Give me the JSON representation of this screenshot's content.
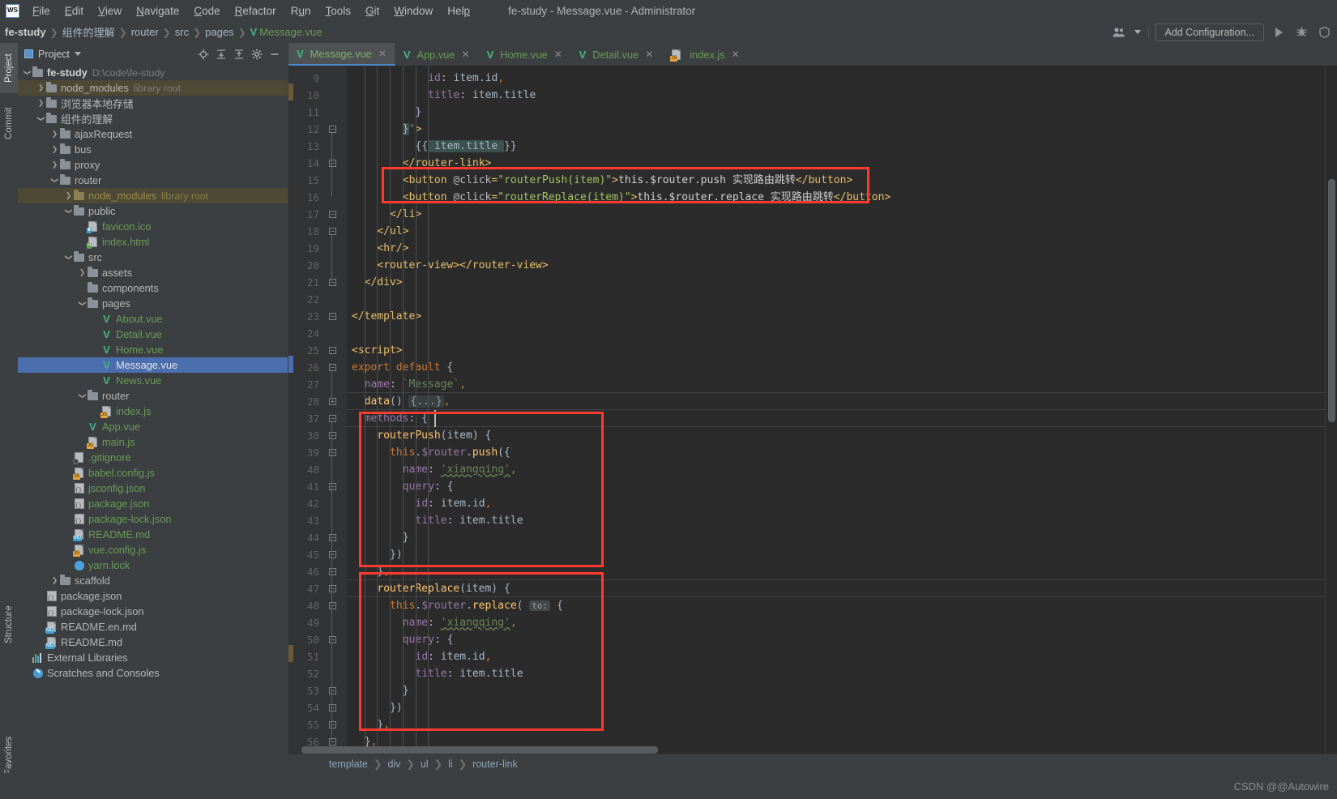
{
  "window": {
    "title": "fe-study - Message.vue - Administrator",
    "logo_text": "WS"
  },
  "menubar": {
    "items": [
      {
        "label": "File",
        "mnemonic": "F"
      },
      {
        "label": "Edit",
        "mnemonic": "E"
      },
      {
        "label": "View",
        "mnemonic": "V"
      },
      {
        "label": "Navigate",
        "mnemonic": "N"
      },
      {
        "label": "Code",
        "mnemonic": "C"
      },
      {
        "label": "Refactor",
        "mnemonic": "R"
      },
      {
        "label": "Run",
        "mnemonic": "u"
      },
      {
        "label": "Tools",
        "mnemonic": "T"
      },
      {
        "label": "Git",
        "mnemonic": "G"
      },
      {
        "label": "Window",
        "mnemonic": "W"
      },
      {
        "label": "Help",
        "mnemonic": "H"
      }
    ]
  },
  "navbar": {
    "crumbs": [
      "fe-study",
      "组件的理解",
      "router",
      "src",
      "pages",
      "Message.vue"
    ],
    "run_config_label": "Add Configuration...",
    "icons": [
      "user-group-icon",
      "run-icon",
      "debug-icon",
      "coverage-icon"
    ]
  },
  "toolstrip": {
    "left_top": [
      "Project",
      "Commit"
    ],
    "left_bottom": [
      "Structure",
      "Favorites"
    ]
  },
  "project_panel": {
    "title": "Project",
    "icons": [
      "locate-icon",
      "expand-all-icon",
      "collapse-all-icon",
      "settings-icon",
      "hide-icon"
    ]
  },
  "tree": [
    {
      "depth": 0,
      "arrow": "down",
      "icon": "folder",
      "label": "fe-study",
      "sub": "D:\\code\\fe-study",
      "style": "bold"
    },
    {
      "depth": 1,
      "arrow": "right",
      "icon": "folder",
      "label": "node_modules",
      "sub": "library root",
      "row": "hl"
    },
    {
      "depth": 1,
      "arrow": "right",
      "icon": "folder",
      "label": "浏览器本地存储",
      "sub": ""
    },
    {
      "depth": 1,
      "arrow": "down",
      "icon": "folder",
      "label": "组件的理解",
      "sub": ""
    },
    {
      "depth": 2,
      "arrow": "right",
      "icon": "folder",
      "label": "ajaxRequest",
      "sub": ""
    },
    {
      "depth": 2,
      "arrow": "right",
      "icon": "folder",
      "label": "bus",
      "sub": ""
    },
    {
      "depth": 2,
      "arrow": "right",
      "icon": "folder",
      "label": "proxy",
      "sub": ""
    },
    {
      "depth": 2,
      "arrow": "down",
      "icon": "folder",
      "label": "router",
      "sub": ""
    },
    {
      "depth": 3,
      "arrow": "right",
      "icon": "folder-olive",
      "label": "node_modules",
      "sub": "library root",
      "row": "hl",
      "style": "olive"
    },
    {
      "depth": 3,
      "arrow": "down",
      "icon": "folder",
      "label": "public",
      "sub": ""
    },
    {
      "depth": 4,
      "arrow": "none",
      "icon": "file-img",
      "label": "favicon.ico",
      "sub": "",
      "style": "green"
    },
    {
      "depth": 4,
      "arrow": "none",
      "icon": "file-html",
      "label": "index.html",
      "sub": "",
      "style": "green"
    },
    {
      "depth": 3,
      "arrow": "down",
      "icon": "folder",
      "label": "src",
      "sub": ""
    },
    {
      "depth": 4,
      "arrow": "right",
      "icon": "folder",
      "label": "assets",
      "sub": ""
    },
    {
      "depth": 4,
      "arrow": "none",
      "icon": "folder",
      "label": "components",
      "sub": ""
    },
    {
      "depth": 4,
      "arrow": "down",
      "icon": "folder",
      "label": "pages",
      "sub": ""
    },
    {
      "depth": 5,
      "arrow": "none",
      "icon": "vue",
      "label": "About.vue",
      "sub": "",
      "style": "green"
    },
    {
      "depth": 5,
      "arrow": "none",
      "icon": "vue",
      "label": "Detail.vue",
      "sub": "",
      "style": "green"
    },
    {
      "depth": 5,
      "arrow": "none",
      "icon": "vue",
      "label": "Home.vue",
      "sub": "",
      "style": "green"
    },
    {
      "depth": 5,
      "arrow": "none",
      "icon": "vue",
      "label": "Message.vue",
      "sub": "",
      "row": "sel",
      "style": "white"
    },
    {
      "depth": 5,
      "arrow": "none",
      "icon": "vue",
      "label": "News.vue",
      "sub": "",
      "style": "green"
    },
    {
      "depth": 4,
      "arrow": "down",
      "icon": "folder",
      "label": "router",
      "sub": ""
    },
    {
      "depth": 5,
      "arrow": "none",
      "icon": "file-js",
      "label": "index.js",
      "sub": "",
      "style": "green"
    },
    {
      "depth": 4,
      "arrow": "none",
      "icon": "vue",
      "label": "App.vue",
      "sub": "",
      "style": "green"
    },
    {
      "depth": 4,
      "arrow": "none",
      "icon": "file-js",
      "label": "main.js",
      "sub": "",
      "style": "green"
    },
    {
      "depth": 3,
      "arrow": "none",
      "icon": "gitignore",
      "label": ".gitignore",
      "sub": "",
      "style": "green"
    },
    {
      "depth": 3,
      "arrow": "none",
      "icon": "file-js",
      "label": "babel.config.js",
      "sub": "",
      "style": "green"
    },
    {
      "depth": 3,
      "arrow": "none",
      "icon": "json",
      "label": "jsconfig.json",
      "sub": "",
      "style": "green"
    },
    {
      "depth": 3,
      "arrow": "none",
      "icon": "json",
      "label": "package.json",
      "sub": "",
      "style": "green"
    },
    {
      "depth": 3,
      "arrow": "none",
      "icon": "json",
      "label": "package-lock.json",
      "sub": "",
      "style": "green"
    },
    {
      "depth": 3,
      "arrow": "none",
      "icon": "file-md",
      "label": "README.md",
      "sub": "",
      "style": "green"
    },
    {
      "depth": 3,
      "arrow": "none",
      "icon": "file-js",
      "label": "vue.config.js",
      "sub": "",
      "style": "green"
    },
    {
      "depth": 3,
      "arrow": "none",
      "icon": "yarn",
      "label": "yarn.lock",
      "sub": "",
      "style": "green"
    },
    {
      "depth": 2,
      "arrow": "right",
      "icon": "folder",
      "label": "scaffold",
      "sub": ""
    },
    {
      "depth": 1,
      "arrow": "none",
      "icon": "json",
      "label": "package.json",
      "sub": ""
    },
    {
      "depth": 1,
      "arrow": "none",
      "icon": "json",
      "label": "package-lock.json",
      "sub": ""
    },
    {
      "depth": 1,
      "arrow": "none",
      "icon": "file-md",
      "label": "README.en.md",
      "sub": ""
    },
    {
      "depth": 1,
      "arrow": "none",
      "icon": "file-md",
      "label": "README.md",
      "sub": ""
    },
    {
      "depth": 0,
      "arrow": "none",
      "icon": "libs",
      "label": "External Libraries",
      "sub": ""
    },
    {
      "depth": 0,
      "arrow": "none",
      "icon": "scratch",
      "label": "Scratches and Consoles",
      "sub": ""
    }
  ],
  "tabs": [
    {
      "label": "Message.vue",
      "icon": "vue-icon",
      "active": true
    },
    {
      "label": "App.vue",
      "icon": "vue-icon",
      "active": false
    },
    {
      "label": "Home.vue",
      "icon": "vue-icon",
      "active": false
    },
    {
      "label": "Detail.vue",
      "icon": "vue-icon",
      "active": false
    },
    {
      "label": "index.js",
      "icon": "js-icon",
      "active": false
    }
  ],
  "editor": {
    "filename": "Message.vue",
    "first_visible_line": 9,
    "last_visible_line": 56,
    "folded_range": "29-36",
    "lines": [
      {
        "n": 9,
        "text": "            id: item.id,"
      },
      {
        "n": 10,
        "text": "            title: item.title"
      },
      {
        "n": 11,
        "text": "          }"
      },
      {
        "n": 12,
        "text": "        }\">"
      },
      {
        "n": 13,
        "text": "          {{ item.title }}"
      },
      {
        "n": 14,
        "text": "        </router-link>"
      },
      {
        "n": 15,
        "text": "        <button @click=\"routerPush(item)\">this.$router.push 实现路由跳转</button>"
      },
      {
        "n": 16,
        "text": "        <button @click=\"routerReplace(item)\">this.$router.replace 实现路由跳转</button>"
      },
      {
        "n": 17,
        "text": "      </li>"
      },
      {
        "n": 18,
        "text": "    </ul>"
      },
      {
        "n": 19,
        "text": "    <hr/>"
      },
      {
        "n": 20,
        "text": "    <router-view></router-view>"
      },
      {
        "n": 21,
        "text": "  </div>"
      },
      {
        "n": 22,
        "text": ""
      },
      {
        "n": 23,
        "text": "</template>"
      },
      {
        "n": 24,
        "text": ""
      },
      {
        "n": 25,
        "text": "<script>"
      },
      {
        "n": 26,
        "text": "export default {"
      },
      {
        "n": 27,
        "text": "  name: `Message`,"
      },
      {
        "n": 28,
        "text": "  data() {...},"
      },
      {
        "n": 37,
        "text": "  methods: {"
      },
      {
        "n": 38,
        "text": "    routerPush(item) {"
      },
      {
        "n": 39,
        "text": "      this.$router.push({"
      },
      {
        "n": 40,
        "text": "        name: 'xiangqing',"
      },
      {
        "n": 41,
        "text": "        query: {"
      },
      {
        "n": 42,
        "text": "          id: item.id,"
      },
      {
        "n": 43,
        "text": "          title: item.title"
      },
      {
        "n": 44,
        "text": "        }"
      },
      {
        "n": 45,
        "text": "      })"
      },
      {
        "n": 46,
        "text": "    },"
      },
      {
        "n": 47,
        "text": "    routerReplace(item) {"
      },
      {
        "n": 48,
        "text": "      this.$router.replace( to: {"
      },
      {
        "n": 49,
        "text": "        name: 'xiangqing',"
      },
      {
        "n": 50,
        "text": "        query: {"
      },
      {
        "n": 51,
        "text": "          id: item.id,"
      },
      {
        "n": 52,
        "text": "          title: item.title"
      },
      {
        "n": 53,
        "text": "        }"
      },
      {
        "n": 54,
        "text": "      })"
      },
      {
        "n": 55,
        "text": "    },"
      },
      {
        "n": 56,
        "text": "  },"
      }
    ],
    "param_hint": "to:",
    "folded_placeholder": "{...}",
    "highlighted_token": "item.title",
    "annotations": [
      {
        "name": "button-lines-box",
        "lines": "15-16"
      },
      {
        "name": "routerPush-method-box",
        "lines": "38-46"
      },
      {
        "name": "routerReplace-method-box",
        "lines": "47-55"
      }
    ]
  },
  "bottom_breadcrumb": [
    "template",
    "div",
    "ul",
    "li",
    "router-link"
  ],
  "watermark": "CSDN @@Autowire",
  "colors": {
    "accent": "#4b6eaf",
    "annotation": "#ff3b30",
    "vue_green": "#41b883",
    "editor_bg": "#2b2b2b",
    "chrome_bg": "#3c3f41"
  }
}
